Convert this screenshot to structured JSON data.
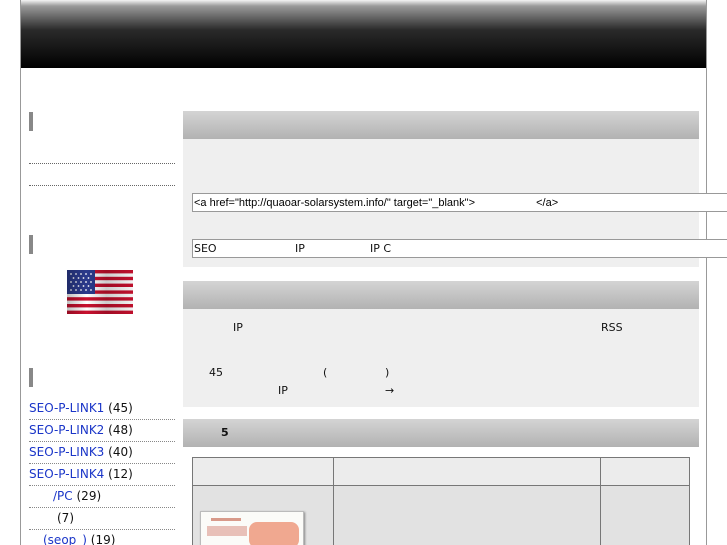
{
  "post": {
    "link_code": "<a href=\"http://quaoar-solarsystem.info/\" target=\"_blank\">                    </a>",
    "field2_a": "SEO",
    "field2_b": "IP",
    "field2_c": "IP   C"
  },
  "section2": {
    "t_ip": "IP",
    "t_rss": "RSS",
    "t_45": "45",
    "t_lparen": "(",
    "t_rparen": ")",
    "t_ip2": "IP",
    "t_arrow": "→"
  },
  "section3": {
    "title": "5"
  },
  "sidebar": {
    "links": [
      {
        "label": "SEO-P-LINK1",
        "count": "(45)"
      },
      {
        "label": "SEO-P-LINK2",
        "count": "(48)"
      },
      {
        "label": "SEO-P-LINK3",
        "count": "(40)"
      },
      {
        "label": "SEO-P-LINK4",
        "count": "(12)"
      },
      {
        "label": "/PC",
        "count": "(29)"
      },
      {
        "label": "",
        "count": "(7)"
      },
      {
        "label": "(seop_)",
        "count": "(19)"
      }
    ]
  }
}
